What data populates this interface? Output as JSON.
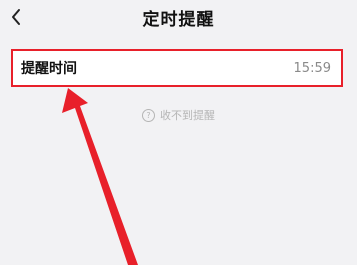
{
  "header": {
    "title": "定时提醒",
    "back_icon": "chevron-left-icon"
  },
  "reminder": {
    "label": "提醒时间",
    "time": "15:59"
  },
  "help": {
    "icon": "question-circle-icon",
    "icon_glyph": "?",
    "text": "收不到提醒"
  },
  "colors": {
    "highlight": "#e8202a",
    "background": "#f2f2f4"
  }
}
